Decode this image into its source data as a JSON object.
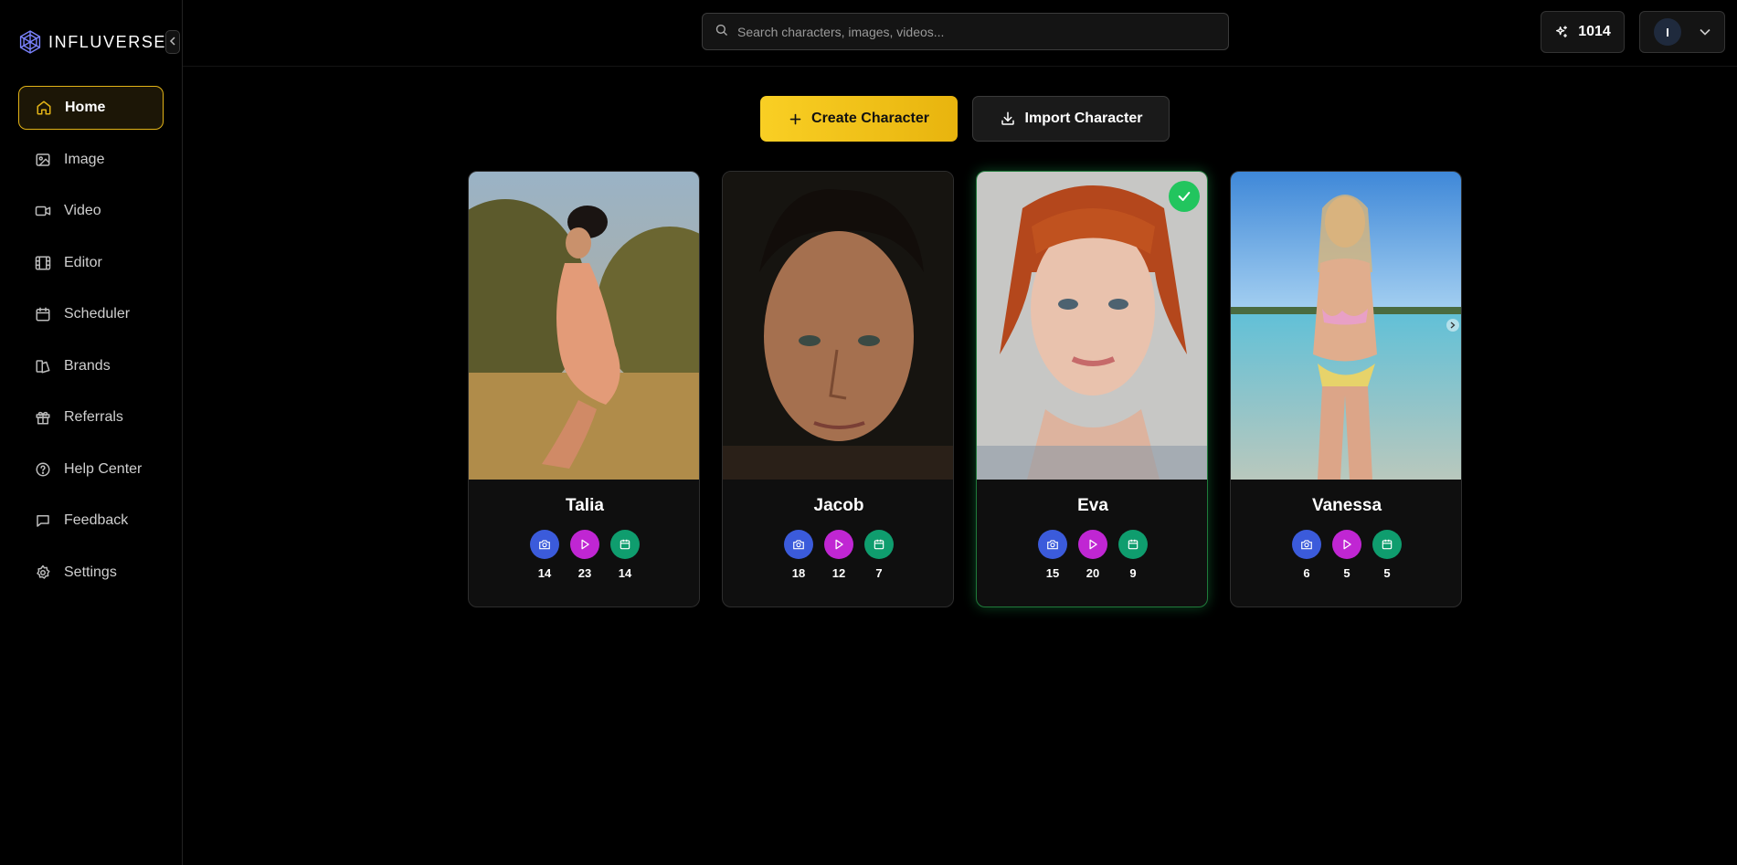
{
  "brand": {
    "name": "INFLUVERSE"
  },
  "sidebar": {
    "items": [
      {
        "label": "Home",
        "icon": "home-icon",
        "active": true
      },
      {
        "label": "Image",
        "icon": "image-icon"
      },
      {
        "label": "Video",
        "icon": "video-icon"
      },
      {
        "label": "Editor",
        "icon": "film-icon"
      },
      {
        "label": "Scheduler",
        "icon": "calendar-icon"
      },
      {
        "label": "Brands",
        "icon": "brands-icon"
      },
      {
        "label": "Referrals",
        "icon": "gift-icon"
      },
      {
        "label": "Help Center",
        "icon": "help-circle-icon"
      },
      {
        "label": "Feedback",
        "icon": "message-icon"
      },
      {
        "label": "Settings",
        "icon": "gear-icon"
      }
    ]
  },
  "search": {
    "placeholder": "Search characters, images, videos..."
  },
  "credits": {
    "value": "1014"
  },
  "account": {
    "initial": "I"
  },
  "actions": {
    "create_label": "Create Character",
    "import_label": "Import Character"
  },
  "characters": [
    {
      "name": "Talia",
      "images": "14",
      "videos": "23",
      "scheduled": "14",
      "selected": false
    },
    {
      "name": "Jacob",
      "images": "18",
      "videos": "12",
      "scheduled": "7",
      "selected": false
    },
    {
      "name": "Eva",
      "images": "15",
      "videos": "20",
      "scheduled": "9",
      "selected": true
    },
    {
      "name": "Vanessa",
      "images": "6",
      "videos": "5",
      "scheduled": "5",
      "selected": false
    }
  ],
  "colors": {
    "accent": "#f5c518",
    "images_stat": "#3b5bdb",
    "videos_stat": "#c026d3",
    "schedule_stat": "#0f9d6e",
    "selected": "#22c55e"
  }
}
